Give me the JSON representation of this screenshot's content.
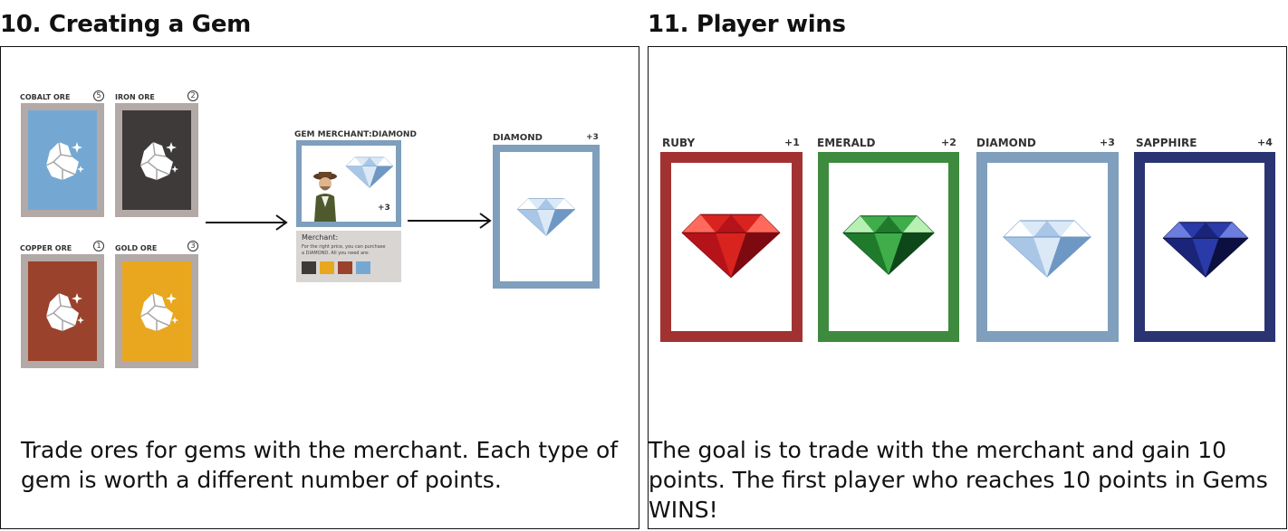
{
  "left": {
    "title": "10. Creating a Gem",
    "caption": "Trade ores for gems with the merchant. Each type of gem is worth a different number of points.",
    "ores": [
      {
        "label": "COBALT ORE",
        "number": "5",
        "color": "#74a8d3"
      },
      {
        "label": "IRON ORE",
        "number": "2",
        "color": "#3d3a39"
      },
      {
        "label": "COPPER ORE",
        "number": "1",
        "color": "#9a422b"
      },
      {
        "label": "GOLD ORE",
        "number": "3",
        "color": "#e9a71f"
      }
    ],
    "merchant": {
      "label": "GEM MERCHANT:DIAMOND",
      "points": "+3",
      "heading": "Merchant:",
      "description_line1": "For the right price, you can purchase",
      "description_line2": "a DIAMOND. All you need are:",
      "frame_color": "#7f9fbd"
    },
    "result": {
      "label": "DIAMOND",
      "points": "+3",
      "frame_color": "#7f9fbd"
    }
  },
  "right": {
    "title": "11. Player wins",
    "caption": "The goal is to trade with the merchant and gain 10 points. The first player who reaches 10 points in Gems WINS!",
    "gems": [
      {
        "label": "RUBY",
        "points": "+1",
        "frame_color": "#a23232",
        "gem_icon": "ruby-icon"
      },
      {
        "label": "EMERALD",
        "points": "+2",
        "frame_color": "#3e8a3e",
        "gem_icon": "emerald-icon"
      },
      {
        "label": "DIAMOND",
        "points": "+3",
        "frame_color": "#7f9fbd",
        "gem_icon": "diamond-icon"
      },
      {
        "label": "SAPPHIRE",
        "points": "+4",
        "frame_color": "#2a3472",
        "gem_icon": "sapphire-icon"
      }
    ]
  }
}
